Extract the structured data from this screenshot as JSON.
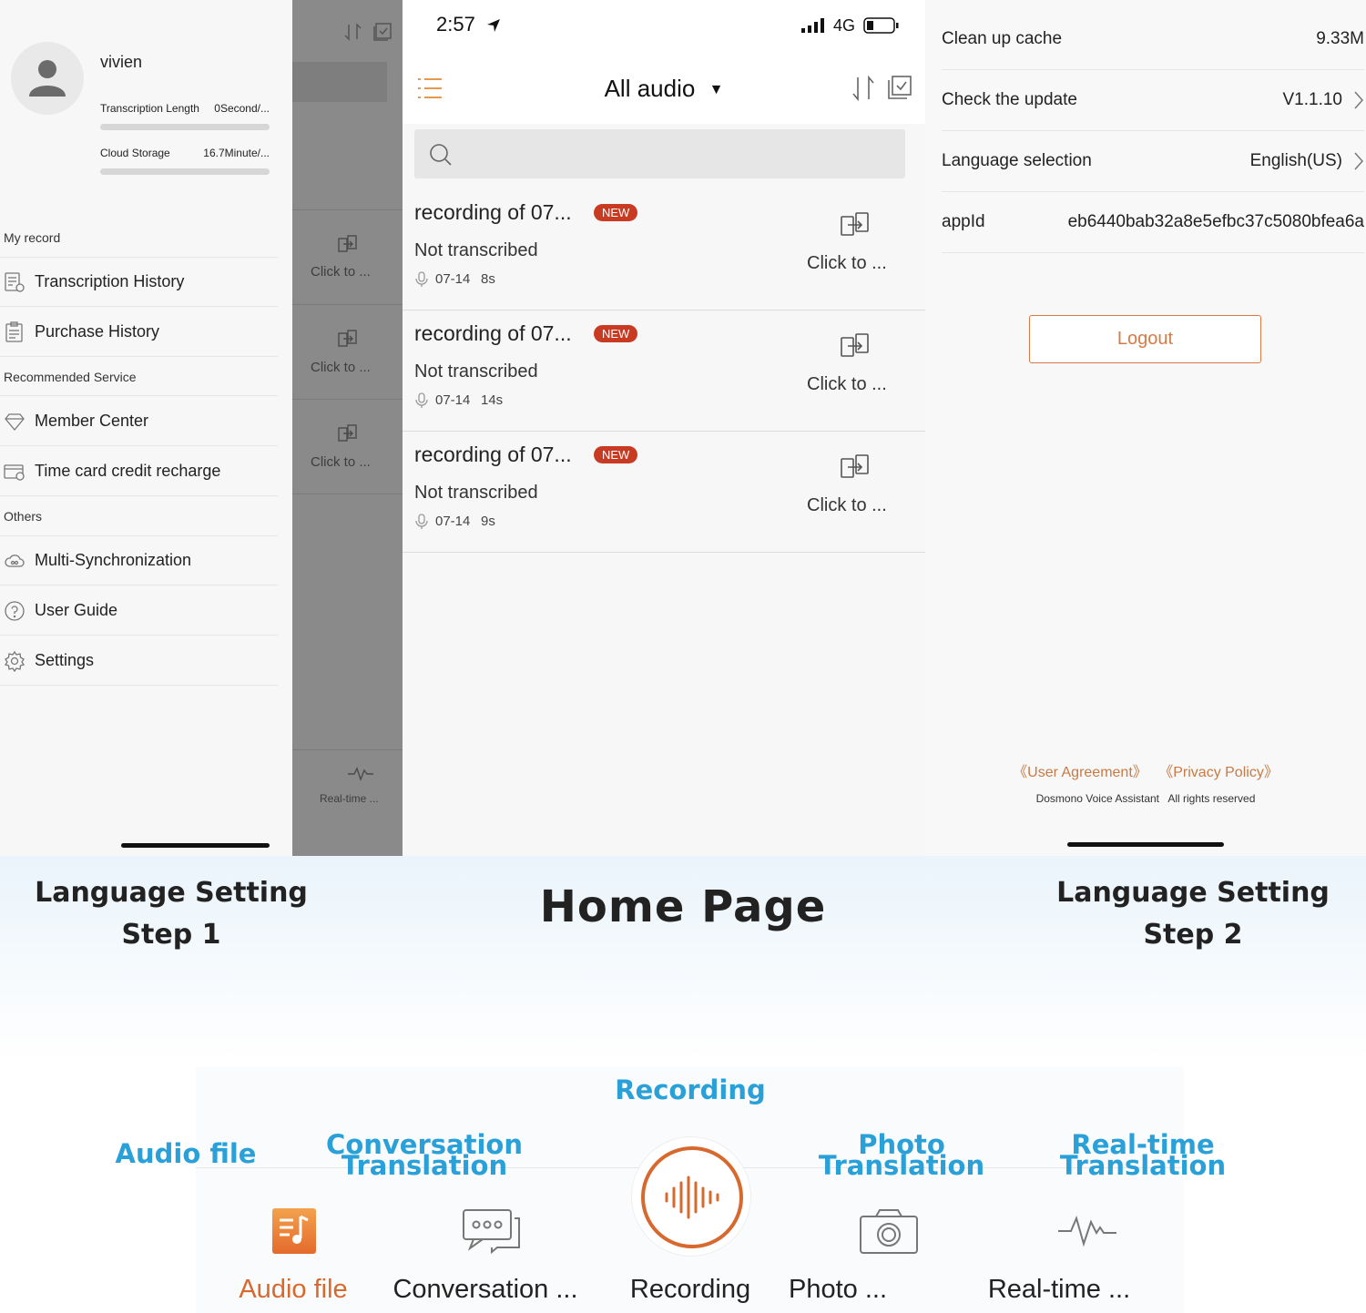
{
  "drawer": {
    "username": "vivien",
    "transcription_length_label": "Transcription Length",
    "transcription_length_value": "0Second/...",
    "cloud_storage_label": "Cloud Storage",
    "cloud_storage_value": "16.7Minute/...",
    "sections": {
      "my_record": "My record",
      "recommended": "Recommended Service",
      "others": "Others"
    },
    "items": {
      "transcription_history": "Transcription History",
      "purchase_history": "Purchase History",
      "member_center": "Member Center",
      "time_card": "Time card credit recharge",
      "multi_sync": "Multi-Synchronization",
      "user_guide": "User Guide",
      "settings": "Settings"
    }
  },
  "overlay": {
    "click_label": "Click to ...",
    "realtime_label": "Real-time ..."
  },
  "home": {
    "status_time": "2:57",
    "status_network": "4G",
    "title": "All audio",
    "search_placeholder": "",
    "records": [
      {
        "title": "recording of 07...",
        "badge": "NEW",
        "status": "Not transcribed",
        "date": "07-14",
        "length": "8s",
        "action": "Click to ..."
      },
      {
        "title": "recording of 07...",
        "badge": "NEW",
        "status": "Not transcribed",
        "date": "07-14",
        "length": "14s",
        "action": "Click to ..."
      },
      {
        "title": "recording of 07...",
        "badge": "NEW",
        "status": "Not transcribed",
        "date": "07-14",
        "length": "9s",
        "action": "Click to ..."
      }
    ]
  },
  "settings": {
    "clean_cache_label": "Clean up cache",
    "clean_cache_value": "9.33M",
    "update_label": "Check the update",
    "update_value": "V1.1.10",
    "language_label": "Language selection",
    "language_value": "English(US)",
    "appid_label": "appId",
    "appid_value": "eb6440bab32a8e5efbc37c5080bfea6a",
    "logout": "Logout",
    "user_agreement": "《User Agreement》",
    "privacy_policy": "《Privacy Policy》",
    "app_name": "Dosmono Voice Assistant",
    "rights": "All rights reserved"
  },
  "captions": {
    "left_line1": "Language Setting",
    "left_line2": "Step 1",
    "center": "Home Page",
    "right_line1": "Language Setting",
    "right_line2": "Step 2"
  },
  "tabbar": {
    "callouts": {
      "recording": "Recording",
      "audio_file": "Audio file",
      "conversation_1": "Conversation",
      "conversation_2": "Translation",
      "photo_1": "Photo",
      "photo_2": "Translation",
      "realtime_1": "Real-time",
      "realtime_2": "Translation"
    },
    "tabs": {
      "audio_file": "Audio file",
      "conversation": "Conversation ...",
      "recording": "Recording",
      "photo": "Photo ...",
      "realtime": "Real-time ..."
    }
  },
  "colors": {
    "accent_orange": "#d7692f",
    "callout_blue": "#2aa0d8",
    "badge_red": "#c83a22"
  }
}
